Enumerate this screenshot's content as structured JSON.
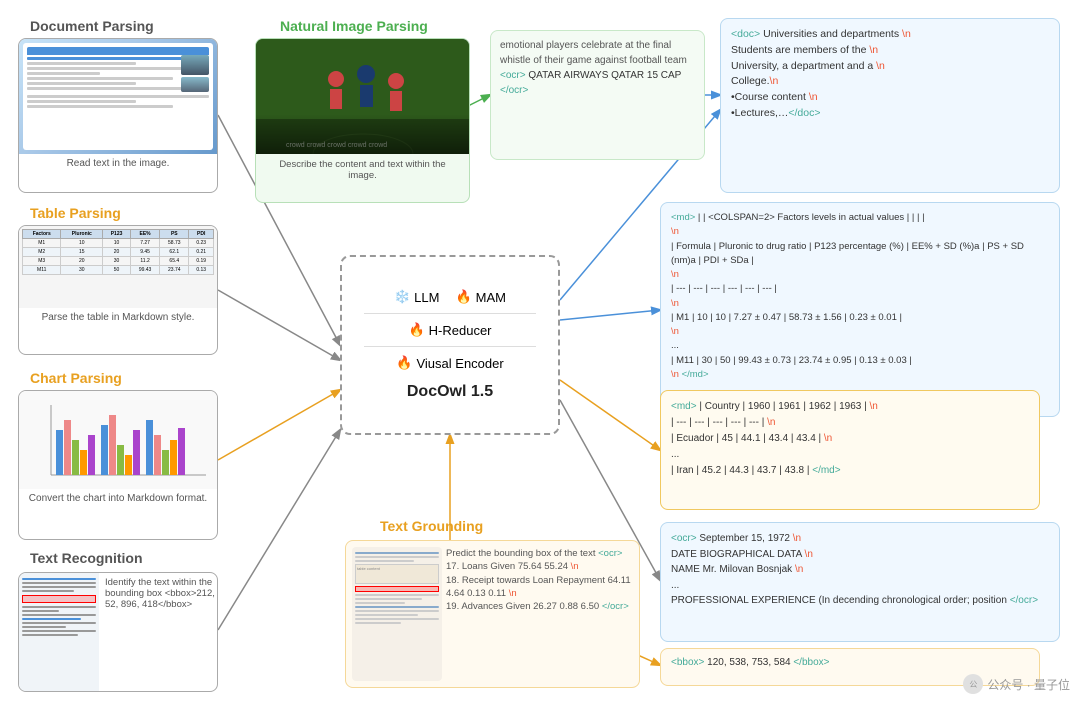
{
  "labels": {
    "document_parsing": "Document Parsing",
    "table_parsing": "Table Parsing",
    "chart_parsing": "Chart Parsing",
    "text_recognition": "Text Recognition",
    "natural_image": "Natural Image Parsing",
    "text_grounding": "Text Grounding",
    "docowl_title": "DocOwl 1.5",
    "llm": "LLM",
    "mam": "🔥MAM",
    "h_reducer": "🔥 H-Reducer",
    "visual_encoder": "🔥 Viusal Encoder"
  },
  "captions": {
    "doc_parsing": "Read text in the image.",
    "table_parsing": "Parse the table in Markdown style.",
    "chart_parsing": "Convert the chart into Markdown format.",
    "text_rec": "Identify the text within the bounding box <bbox>212, 52, 896, 418</bbox>",
    "natural_image": "Describe the content and text within the image.",
    "text_grounding": "Predict the bounding box of the text <ocr> 17. Loans Given 75.64 55.24 \\n 18. Receipt towards Loan Repayment 64.11 4.64 0.13 0.11 \\n 19. Advances Given 26.27 0.88 6.50 </ocr>"
  },
  "outputs": {
    "doc_top": "emotional players celebrate at the final whistle of their game against football team <ocr> QATAR AIRWAYS QATAR 15 CAP </ocr>",
    "doc_right": "<doc> Universities and departments \\n Students are members of the \\n University, a department and a \\n College.\\n •Course content \\n •Lectures,…</doc>",
    "table_md": "<md> | | <COLSPAN=2> Factors levels in actual values | | | | \\n | Formula | Pluronic to drug ratio | P123 percentage (%) | EE% + SD (%)a | PS + SD (nm)a | PDI + SDa | \\n | --- | --- | --- | --- | --- | --- | \\n | M1 | 10 | 10 | 7.27 ± 0.47 | 58.73 ± 1.56 | 0.23 ± 0.01 | \\n ... \\n | M11 | 30 | 50 | 99.43 ± 0.73 | 23.74 ± 0.95 | 0.13 ± 0.03 | \\n </md>",
    "country_md": "<md> | Country | 1960 | 1961 | 1962 | 1963 | \\n | --- | --- | --- | --- | --- | \\n | Ecuador | 45 | 44.1 | 43.4 | 43.4 | \\n ... \\n | Iran | 45.2 | 44.3 | 43.7 | 43.8 | </md>",
    "ocr_out": "<ocr> September 15, 1972 \\n DATE BIOGRAPHICAL DATA \\n NAME Mr. Milovan Bosnjak \\n ... \\n PROFESSIONAL EXPERIENCE (In decending chronological order; position </ocr>",
    "bbox_out": "<bbox> 120, 538, 753, 584 </bbox>"
  },
  "watermark": "公众号 · 量子位"
}
